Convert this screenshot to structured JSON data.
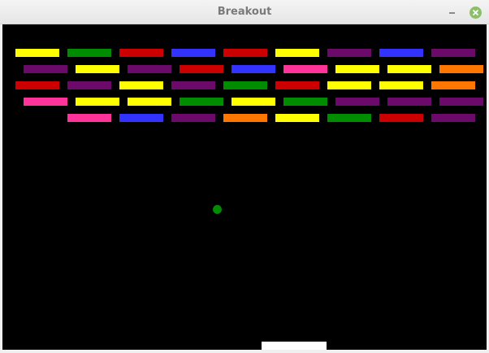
{
  "window": {
    "title": "Breakout"
  },
  "colors": {
    "yellow": "#ffff00",
    "green": "#008c00",
    "red": "#cc0000",
    "blue": "#3333ff",
    "purple": "#6b0a6b",
    "pink": "#ff3399",
    "orange": "#ff7700",
    "ball": "#008c00",
    "paddle": "#ffffff",
    "background": "#000000"
  },
  "rows": [
    [
      "yellow",
      "green",
      "red",
      "blue",
      "red",
      "yellow",
      "purple",
      "blue",
      "purple"
    ],
    [
      "purple",
      "yellow",
      "purple",
      "red",
      "blue",
      "pink",
      "yellow",
      "yellow",
      "orange"
    ],
    [
      "red",
      "purple",
      "yellow",
      "purple",
      "green",
      "red",
      "yellow",
      "yellow",
      "orange"
    ],
    [
      "pink",
      "yellow",
      "yellow",
      "green",
      "yellow",
      "green",
      "purple",
      "purple",
      "purple"
    ],
    [
      "pink",
      "blue",
      "purple",
      "orange",
      "yellow",
      "green",
      "red",
      "purple"
    ]
  ]
}
